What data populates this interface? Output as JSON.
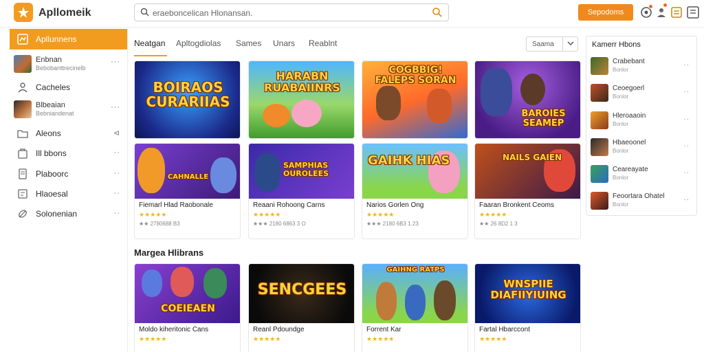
{
  "app": {
    "title": "Apllomeik"
  },
  "search": {
    "text": "eraeboncelican Hlonansan."
  },
  "topbar": {
    "signin_label": "Sepodoms"
  },
  "sidebar": {
    "items": [
      {
        "label": "Apllunnens",
        "icon": "grid-icon",
        "trail": ""
      },
      {
        "label": "Enbnan",
        "sub": "Bebobanttrecinelb",
        "icon": "avatar",
        "trail": "···"
      },
      {
        "label": "Cacheles",
        "icon": "person-icon",
        "trail": ""
      },
      {
        "label": "Blbeaian",
        "sub": "Bebniandenat",
        "icon": "avatar",
        "trail": "···"
      },
      {
        "label": "Aleons",
        "icon": "folder-icon",
        "trail": "⊲"
      },
      {
        "label": "Ill bbons",
        "icon": "bag-icon",
        "trail": "··"
      },
      {
        "label": "Plaboorc",
        "icon": "file-icon",
        "trail": "··"
      },
      {
        "label": "Hlaoesal",
        "icon": "doc-icon",
        "trail": "··"
      },
      {
        "label": "Solonenian",
        "icon": "leaf-icon",
        "trail": "··"
      }
    ]
  },
  "tabs": [
    {
      "label": "Neatgan"
    },
    {
      "label": "Apltogdiolas"
    },
    {
      "label": "Sames"
    },
    {
      "label": "Unars"
    },
    {
      "label": "Reablnt"
    }
  ],
  "sort": {
    "label": "Saama"
  },
  "cards_top": [
    {
      "thumb": "BOIRAOS CURARIIAS",
      "name": "",
      "rating": "",
      "meta": ""
    },
    {
      "thumb": "HARABN RUABAIINRS",
      "name": "",
      "rating": "",
      "meta": ""
    },
    {
      "thumb": "COGBBIG! FALEPS SORAN",
      "name": "",
      "rating": "",
      "meta": ""
    },
    {
      "thumb": "BAROIES SEAMEP",
      "name": "",
      "rating": "",
      "meta": ""
    },
    {
      "thumb": "CAHNALLE",
      "name": "Fiemarl Hlad Raobonale",
      "rating": "★★★★★",
      "meta": "★★ 2780688 B3"
    },
    {
      "thumb": "SAMPHIAS OUROLEES",
      "name": "Reaani Rohoong Carns",
      "rating": "★★★★★",
      "meta": "★★★ 2180 6863 3 O"
    },
    {
      "thumb": "GAIHK HIAS",
      "name": "Narios Gorlen Ong",
      "rating": "★★★★★",
      "meta": "★★★ 2180 6B3 1.23"
    },
    {
      "thumb": "NAILS GAIEN",
      "name": "Faaran Bronkent Ceoms",
      "rating": "★★★★★",
      "meta": "★★ 26 8D2 1 3"
    }
  ],
  "section": {
    "title": "Margea Hlibrans"
  },
  "cards_bottom": [
    {
      "thumb": "COEIEAEN",
      "name": "Moldo kiheritonic Cans",
      "rating": "★★★★★",
      "meta": ""
    },
    {
      "thumb": "SENCGEES",
      "name": "Reanl Pdoundge",
      "rating": "★★★★★",
      "meta": ""
    },
    {
      "thumb": "GAIHNG RATPS",
      "name": "Forrent Kar",
      "rating": "★★★★★",
      "meta": ""
    },
    {
      "thumb": "WNSPIIE DIAFIIYIUING",
      "name": "Fartal Hbarccont",
      "rating": "★★★★★",
      "meta": ""
    }
  ],
  "right_panel": {
    "title": "Kamerr Hbons",
    "items": [
      {
        "title": "Crabebant",
        "sub": "Bonlor"
      },
      {
        "title": "Ceoegoerl",
        "sub": "Bonlor"
      },
      {
        "title": "Hleroaaoin",
        "sub": "Bonlor"
      },
      {
        "title": "Hbaeoonel",
        "sub": "Bonlor"
      },
      {
        "title": "Ceareayate",
        "sub": "Bonlor"
      },
      {
        "title": "Feoortara Ohatel",
        "sub": "Bonlor"
      }
    ]
  },
  "colors": {
    "accent": "#f29c1f",
    "signin": "#f08a1c",
    "star": "#f3b51b"
  }
}
